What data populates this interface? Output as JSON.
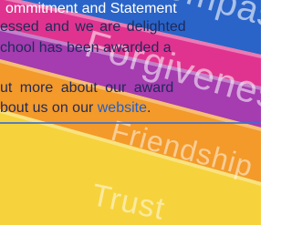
{
  "background_words": {
    "compassion": "Compassion",
    "forgiveness": "Forgiveness",
    "friendship": "Friendship",
    "trust": "Trust"
  },
  "text": {
    "line1": "ommitment and Statement",
    "line2": "essed and we are delighted",
    "line3": "chool has been awarded a",
    "line4": "ut more about our award",
    "line5_prefix": "bout us on our ",
    "link_text": "website",
    "line5_suffix": "."
  },
  "colors": {
    "body_text": "#1f2a5a",
    "link": "#1e5fd0",
    "stripe_blue": "#2a64c9",
    "stripe_pink": "#e0338f",
    "stripe_purple": "#a53cb0",
    "stripe_orange": "#f39a2a",
    "stripe_yellow": "#f6d33c"
  }
}
